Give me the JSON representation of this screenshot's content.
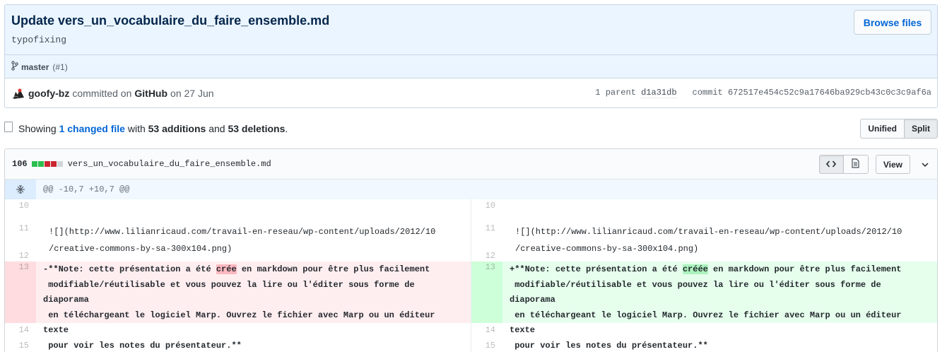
{
  "commit": {
    "title": "Update vers_un_vocabulaire_du_faire_ensemble.md",
    "description": "typofixing",
    "browse_files_label": "Browse files",
    "branch": "master",
    "pr": "(#1)",
    "author": "goofy-bz",
    "committed_on_label": "committed on",
    "committer": "GitHub",
    "date_label": "on 27 Jun",
    "parent_label": "1 parent",
    "parent_sha": "d1a31db",
    "commit_label": "commit",
    "commit_sha": "672517e454c52c9a17646ba929cb43c0c3c9af6a"
  },
  "summary": {
    "showing": "Showing",
    "changed_files": "1 changed file",
    "with": "with",
    "additions": "53 additions",
    "and": "and",
    "deletions": "53 deletions",
    "period": "."
  },
  "view_toggle": {
    "unified": "Unified",
    "split": "Split"
  },
  "file": {
    "changes": "106",
    "name": "vers_un_vocabulaire_du_faire_ensemble.md",
    "view_label": "View",
    "diffstat_colors": [
      "#2cbe4e",
      "#2cbe4e",
      "#cb2431",
      "#cb2431",
      "#d1d5da"
    ],
    "hunk_header": "@@ -10,7 +10,7 @@"
  },
  "diff": {
    "left": [
      {
        "num": "10",
        "type": "ctx",
        "text": ""
      },
      {
        "num": "11",
        "type": "ctx",
        "text": "![](http://www.lilianricaud.com/travail-en-reseau/wp-content/uploads/2012/10\n/creative-commons-by-sa-300x104.png)"
      },
      {
        "num": "12",
        "type": "ctx",
        "text": ""
      },
      {
        "num": "13",
        "type": "del",
        "marker": "-",
        "before": "**Note: cette présentation a été ",
        "highlight": "crée",
        "after": " en markdown pour être plus facilement\nmodifiable/réutilisable et vous pouvez la lire ou l'éditer sous forme de diaporama\nen téléchargeant le logiciel Marp. Ouvrez le fichier avec Marp ou un éditeur texte\npour voir les notes du présentateur.**"
      },
      {
        "num": "14",
        "type": "ctx",
        "text": ""
      },
      {
        "num": "15",
        "type": "ctx",
        "text": ""
      }
    ],
    "right": [
      {
        "num": "10",
        "type": "ctx",
        "text": ""
      },
      {
        "num": "11",
        "type": "ctx",
        "text": "![](http://www.lilianricaud.com/travail-en-reseau/wp-content/uploads/2012/10\n/creative-commons-by-sa-300x104.png)"
      },
      {
        "num": "12",
        "type": "ctx",
        "text": ""
      },
      {
        "num": "13",
        "type": "add",
        "marker": "+",
        "before": "**Note: cette présentation a été ",
        "highlight": "créée",
        "after": " en markdown pour être plus facilement\nmodifiable/réutilisable et vous pouvez la lire ou l'éditer sous forme de diaporama\nen téléchargeant le logiciel Marp. Ouvrez le fichier avec Marp ou un éditeur texte\npour voir les notes du présentateur.**"
      },
      {
        "num": "14",
        "type": "ctx",
        "text": ""
      },
      {
        "num": "15",
        "type": "ctx",
        "text": ""
      }
    ]
  }
}
